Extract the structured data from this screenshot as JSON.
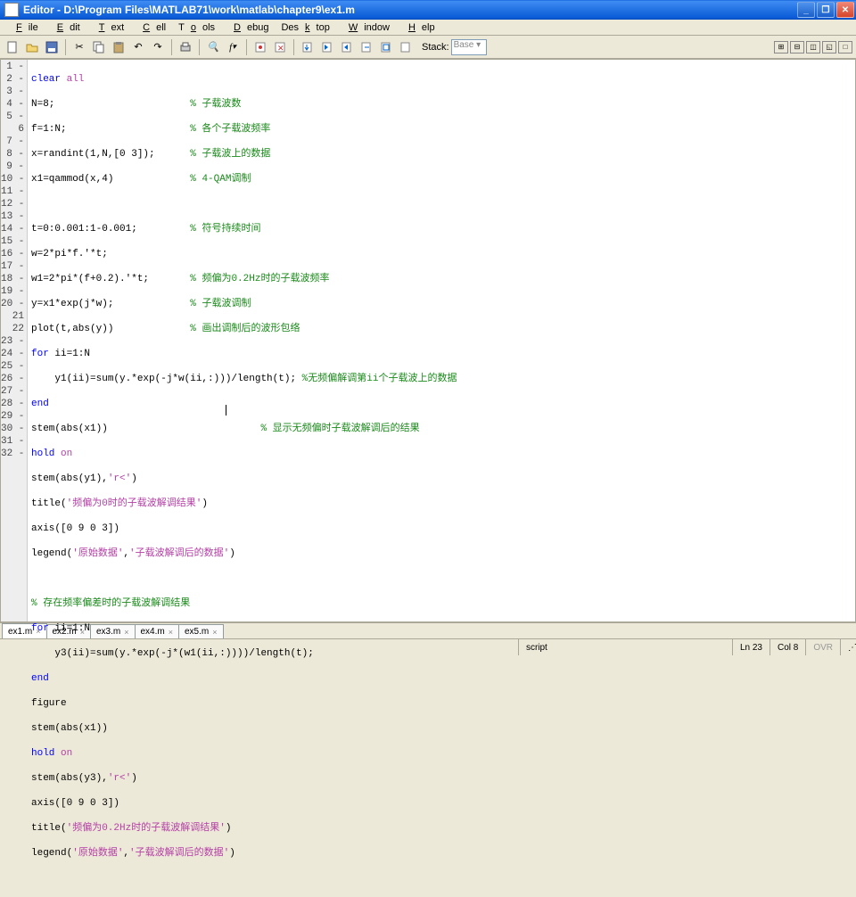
{
  "title": "Editor - D:\\Program Files\\MATLAB71\\work\\matlab\\chapter9\\ex1.m",
  "menu": {
    "file": "File",
    "edit": "Edit",
    "text": "Text",
    "cell": "Cell",
    "tools": "Tools",
    "debug": "Debug",
    "desktop": "Desktop",
    "window": "Window",
    "help": "Help"
  },
  "toolbar": {
    "stack_label": "Stack:",
    "stack_value": "Base"
  },
  "gutter": [
    "1 -",
    "2 -",
    "3 -",
    "4 -",
    "5 -",
    "6",
    "7 -",
    "8 -",
    "9 -",
    "10 -",
    "11 -",
    "12 -",
    "13 -",
    "14 -",
    "15 -",
    "16 -",
    "17 -",
    "18 -",
    "19 -",
    "20 -",
    "21",
    "22",
    "23 -",
    "24 -",
    "25 -",
    "26 -",
    "27 -",
    "28 -",
    "29 -",
    "30 -",
    "31 -",
    "32 -"
  ],
  "code": {
    "l1": {
      "k1": "clear ",
      "k2": "all"
    },
    "l2": {
      "t": "N=8;",
      "pad": "                       ",
      "c": "% 子载波数"
    },
    "l3": {
      "t": "f=1:N;",
      "pad": "                     ",
      "c": "% 各个子载波频率"
    },
    "l4": {
      "t": "x=randint(1,N,[0 3]);",
      "pad": "      ",
      "c": "% 子载波上的数据"
    },
    "l5": {
      "t": "x1=qammod(x,4)",
      "pad": "             ",
      "c": "% 4-QAM调制"
    },
    "l6": "",
    "l7": {
      "t": "t=0:0.001:1-0.001;",
      "pad": "         ",
      "c": "% 符号持续时间"
    },
    "l8": {
      "t": "w=2*pi*f.'*t;"
    },
    "l9": {
      "t": "w1=2*pi*(f+0.2).'*t;",
      "pad": "       ",
      "c": "% 频偏为0.2Hz时的子载波频率"
    },
    "l10": {
      "t": "y=x1*exp(j*w);",
      "pad": "             ",
      "c": "% 子载波调制"
    },
    "l11": {
      "t": "plot(t,abs(y))",
      "pad": "             ",
      "c": "% 画出调制后的波形包络"
    },
    "l12": {
      "k": "for ",
      "t": "ii=1:N"
    },
    "l13": {
      "t": "    y1(ii)=sum(y.*exp(-j*w(ii,:)))/length(t); ",
      "c": "%无频偏解调第ii个子载波上的数据"
    },
    "l14": {
      "k": "end"
    },
    "l15": {
      "t": "stem(abs(x1))",
      "pad": "                          ",
      "c": "% 显示无频偏时子载波解调后的结果"
    },
    "l16": {
      "k1": "hold ",
      "k2": "on"
    },
    "l17": {
      "t1": "stem(abs(y1),",
      "s": "'r<'",
      "t2": ")"
    },
    "l18": {
      "t1": "title(",
      "s": "'频偏为0时的子载波解调结果'",
      "t2": ")"
    },
    "l19": {
      "t": "axis([0 9 0 3])"
    },
    "l20": {
      "t1": "legend(",
      "s1": "'原始数据'",
      "t2": ",",
      "s2": "'子载波解调后的数据'",
      "t3": ")"
    },
    "l21": "",
    "l22": {
      "c": "% 存在频率偏差时的子载波解调结果"
    },
    "l23": {
      "k": "for ",
      "t": "ii=1:N"
    },
    "l24": {
      "t": "    y3(ii)=sum(y.*exp(-j*(w1(ii,:))))/length(t);"
    },
    "l25": {
      "k": "end"
    },
    "l26": {
      "t": "figure"
    },
    "l27": {
      "t": "stem(abs(x1))"
    },
    "l28": {
      "k1": "hold ",
      "k2": "on"
    },
    "l29": {
      "t1": "stem(abs(y3),",
      "s": "'r<'",
      "t2": ")"
    },
    "l30": {
      "t": "axis([0 9 0 3])"
    },
    "l31": {
      "t1": "title(",
      "s": "'频偏为0.2Hz时的子载波解调结果'",
      "t2": ")"
    },
    "l32": {
      "t1": "legend(",
      "s1": "'原始数据'",
      "t2": ",",
      "s2": "'子载波解调后的数据'",
      "t3": ")"
    }
  },
  "tabs": [
    "ex1.m",
    "ex2.m",
    "ex3.m",
    "ex4.m",
    "ex5.m"
  ],
  "status": {
    "type": "script",
    "ln": "Ln  23",
    "col": "Col  8",
    "ovr": "OVR"
  }
}
